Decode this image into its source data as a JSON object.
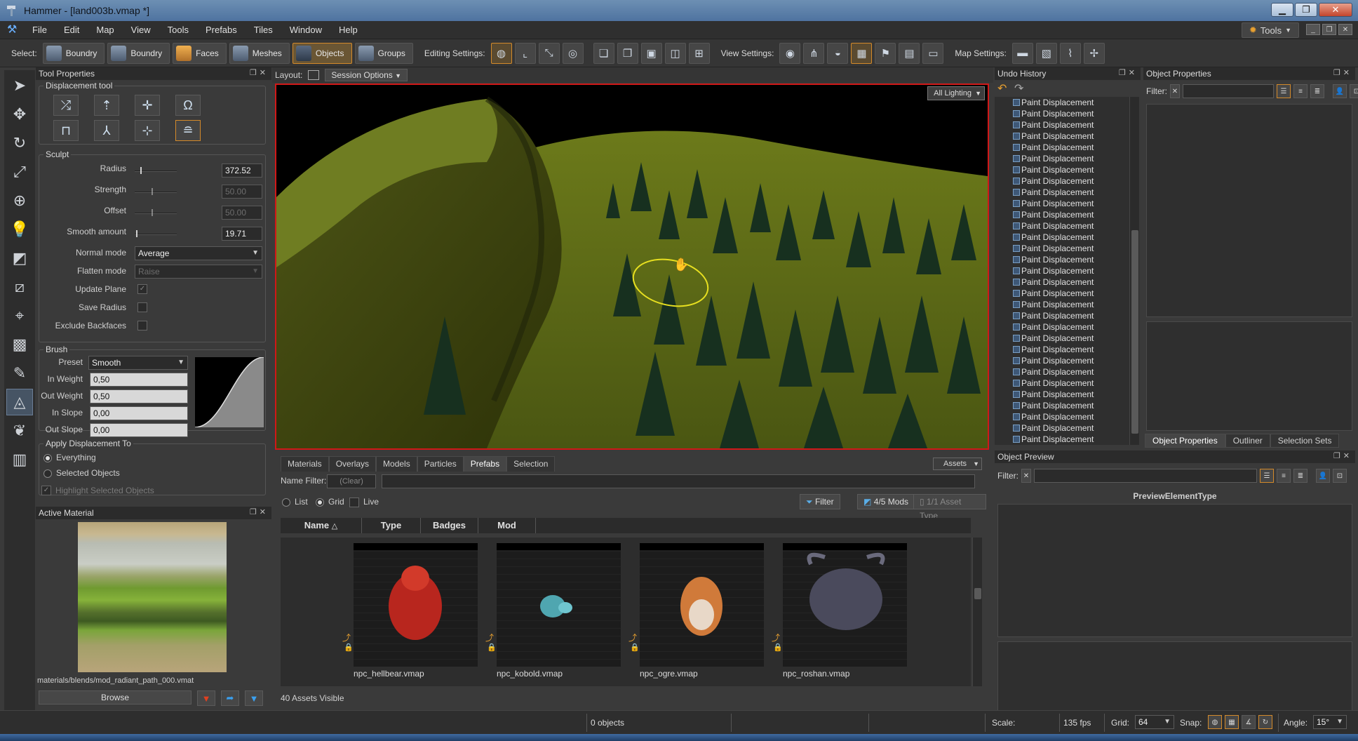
{
  "window": {
    "title": "Hammer - [land003b.vmap *]"
  },
  "menu": [
    "File",
    "Edit",
    "Map",
    "View",
    "Tools",
    "Prefabs",
    "Tiles",
    "Window",
    "Help"
  ],
  "tools_button": "Tools",
  "toolbar": {
    "select_label": "Select:",
    "select_buttons": [
      "Boundry",
      "Boundry",
      "Faces",
      "Meshes",
      "Objects",
      "Groups"
    ],
    "editing_label": "Editing Settings:",
    "view_label": "View Settings:",
    "map_label": "Map Settings:"
  },
  "tool_properties": {
    "title": "Tool Properties",
    "displacement_group": "Displacement tool",
    "sculpt_group": "Sculpt",
    "radius_label": "Radius",
    "radius_value": "372.52",
    "strength_label": "Strength",
    "strength_value": "50.00",
    "offset_label": "Offset",
    "offset_value": "50.00",
    "smooth_label": "Smooth amount",
    "smooth_value": "19.71",
    "normal_mode_label": "Normal mode",
    "normal_mode_value": "Average",
    "flatten_mode_label": "Flatten mode",
    "flatten_mode_value": "Raise",
    "update_plane_label": "Update Plane",
    "save_radius_label": "Save Radius",
    "exclude_backfaces_label": "Exclude Backfaces",
    "brush_group": "Brush",
    "preset_label": "Preset",
    "preset_value": "Smooth",
    "in_weight_label": "In Weight",
    "in_weight_value": "0,50",
    "out_weight_label": "Out Weight",
    "out_weight_value": "0,50",
    "in_slope_label": "In Slope",
    "in_slope_value": "0,00",
    "out_slope_label": "Out Slope",
    "out_slope_value": "0,00",
    "apply_group": "Apply Displacement To",
    "everything_label": "Everything",
    "selected_objects_label": "Selected Objects",
    "highlight_label": "Highlight Selected Objects"
  },
  "active_material": {
    "title": "Active Material",
    "path": "materials/blends/mod_radiant_path_000.vmat",
    "browse_label": "Browse"
  },
  "layout": {
    "label": "Layout:",
    "session_options": "Session Options"
  },
  "viewport": {
    "lighting": "All Lighting"
  },
  "assets": {
    "tabs": [
      "Materials",
      "Overlays",
      "Models",
      "Particles",
      "Prefabs",
      "Selection"
    ],
    "active_tab": "Prefabs",
    "assets_dropdown": "Assets",
    "name_filter_label": "Name Filter:",
    "clear_label": "(Clear)",
    "view_list": "List",
    "view_grid": "Grid",
    "live_label": "Live",
    "filter_button": "Filter",
    "mods_button": "4/5 Mods",
    "asset_type_button": "1/1 Asset Type",
    "columns": [
      "Name",
      "Type",
      "Badges",
      "Mod"
    ],
    "items": [
      {
        "name": "npc_hellbear.vmap",
        "color": "#b8261e"
      },
      {
        "name": "npc_kobold.vmap",
        "color": "#4fa6b0"
      },
      {
        "name": "npc_ogre.vmap",
        "color": "#d07a3a"
      },
      {
        "name": "npc_roshan.vmap",
        "color": "#4a4a5c"
      }
    ],
    "visible_count": "40 Assets Visible"
  },
  "undo_history": {
    "title": "Undo History",
    "items": [
      "Paint Displacement",
      "Paint Displacement",
      "Paint Displacement",
      "Paint Displacement",
      "Paint Displacement",
      "Paint Displacement",
      "Paint Displacement",
      "Paint Displacement",
      "Paint Displacement",
      "Paint Displacement",
      "Paint Displacement",
      "Paint Displacement",
      "Paint Displacement",
      "Paint Displacement",
      "Paint Displacement",
      "Paint Displacement",
      "Paint Displacement",
      "Paint Displacement",
      "Paint Displacement",
      "Paint Displacement",
      "Paint Displacement",
      "Paint Displacement",
      "Paint Displacement",
      "Paint Displacement",
      "Paint Displacement",
      "Paint Displacement",
      "Paint Displacement",
      "Paint Displacement",
      "Paint Displacement",
      "Paint Displacement",
      "Paint Displacement"
    ]
  },
  "object_properties": {
    "title": "Object Properties",
    "filter_label": "Filter:",
    "tabs": [
      "Object Properties",
      "Outliner",
      "Selection Sets"
    ]
  },
  "object_preview": {
    "title": "Object Preview",
    "filter_label": "Filter:",
    "element_type": "PreviewElementType"
  },
  "status": {
    "objects": "0 objects",
    "scale_label": "Scale:",
    "fps": "135 fps",
    "grid_label": "Grid:",
    "grid_value": "64",
    "snap_label": "Snap:",
    "angle_label": "Angle:",
    "angle_value": "15°"
  },
  "colors": {
    "accent": "#d48a2a",
    "selection_border": "#d01818",
    "brush_ring": "#e8e020"
  }
}
